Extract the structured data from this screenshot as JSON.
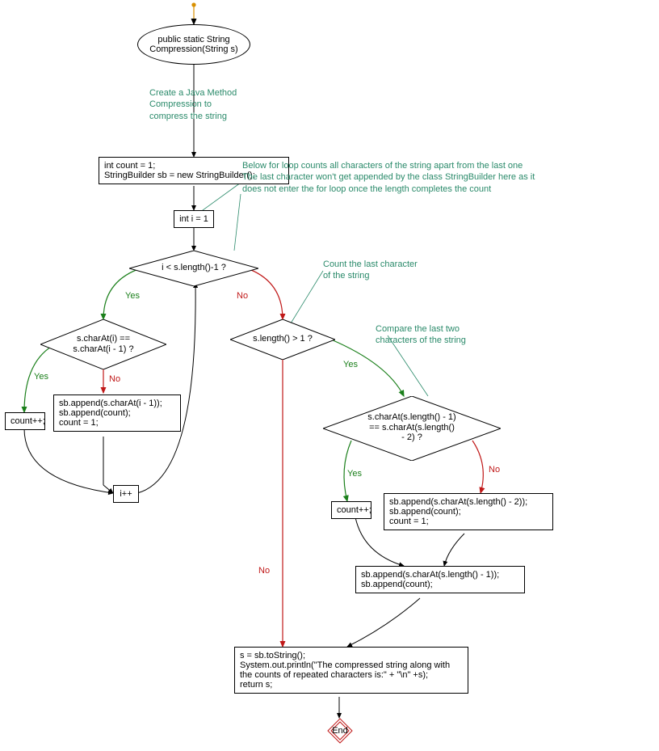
{
  "nodes": {
    "start": "public static String\nCompression(String s)",
    "ann1": "Create a Java Method\nCompression to\ncompress the string",
    "init": "int count = 1;\nStringBuilder sb = new StringBuilder();",
    "ann2": "Below for loop counts all characters of the string apart from the last one\nThe last character won't get appended by the class StringBuilder here as it\ndoes not enter the for loop once the length completes the count",
    "loopInit": "int i = 1",
    "dec1": " i < s.length()-1 ?",
    "ann3": "Count the last character\nof the string",
    "dec2": "s.charAt(i) ==\ns.charAt(i - 1) ?",
    "dec3": "s.length() > 1 ?",
    "ann4": "Compare the last two\ncharacters of the string",
    "countpp1": "count++;",
    "appendBlock1": "sb.append(s.charAt(i - 1));\nsb.append(count);\ncount = 1;",
    "incr": "i++",
    "dec4": "s.charAt(s.length() - 1)\n== s.charAt(s.length()\n- 2) ?",
    "countpp2": "count++;",
    "appendBlock2": "sb.append(s.charAt(s.length() - 2));\nsb.append(count);\ncount = 1;",
    "appendBlock3": "sb.append(s.charAt(s.length() - 1));\nsb.append(count);",
    "finalBlock": "s = sb.toString();\nSystem.out.println(\"The compressed string along with\nthe counts of repeated characters is:\" + \"\\n\" +s);\nreturn s;",
    "end": "End"
  },
  "labels": {
    "yes": "Yes",
    "no": "No"
  }
}
